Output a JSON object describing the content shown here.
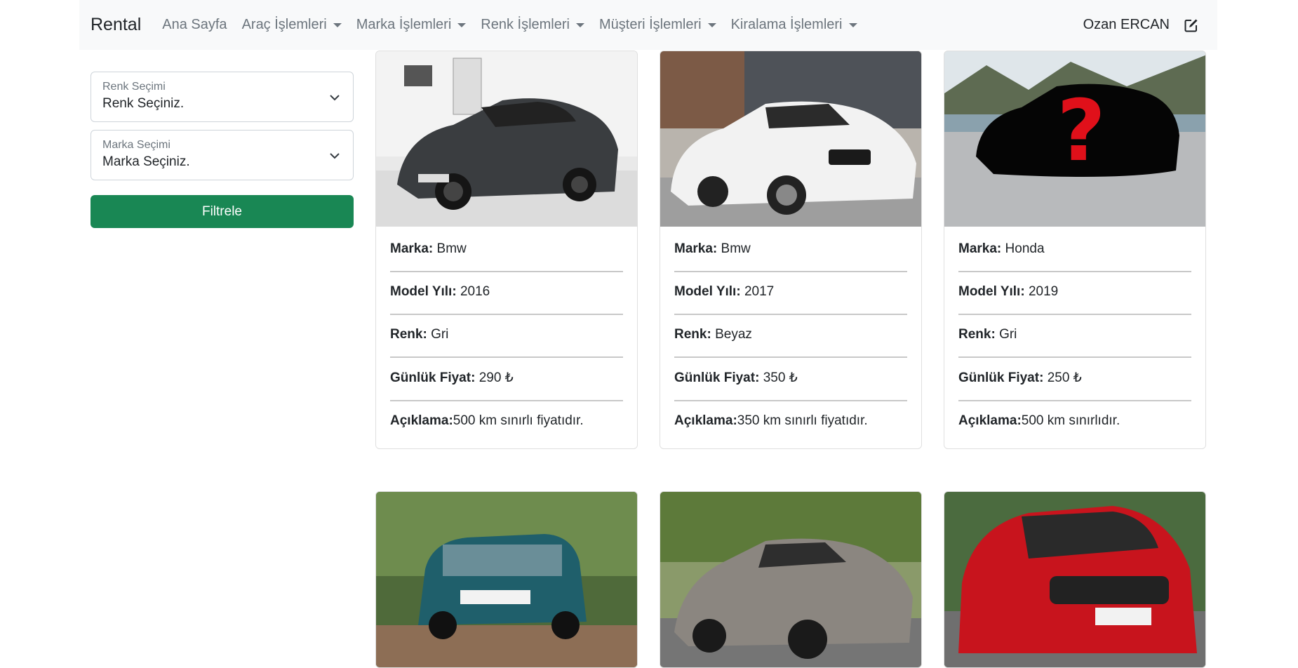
{
  "navbar": {
    "brand": "Rental",
    "items": [
      {
        "label": "Ana Sayfa",
        "dropdown": false
      },
      {
        "label": "Araç İşlemleri",
        "dropdown": true
      },
      {
        "label": "Marka İşlemleri",
        "dropdown": true
      },
      {
        "label": "Renk İşlemleri",
        "dropdown": true
      },
      {
        "label": "Müşteri İşlemleri",
        "dropdown": true
      },
      {
        "label": "Kiralama İşlemleri",
        "dropdown": true
      }
    ],
    "user_name": "Ozan ERCAN",
    "edit_icon": "edit-icon"
  },
  "filters": {
    "color_select": {
      "label": "Renk Seçimi",
      "value": "Renk Seçiniz."
    },
    "brand_select": {
      "label": "Marka Seçimi",
      "value": "Marka Seçiniz."
    },
    "filter_button": "Filtrele"
  },
  "cards": [
    {
      "brand_label": "Marka:",
      "brand": "Bmw",
      "year_label": "Model Yılı:",
      "year": "2016",
      "color_label": "Renk:",
      "color": "Gri",
      "price_label": "Günlük Fiyat:",
      "price": "290 ₺",
      "desc_label": "Açıklama:",
      "desc": "500 km sınırlı fiyatıdır."
    },
    {
      "brand_label": "Marka:",
      "brand": "Bmw",
      "year_label": "Model Yılı:",
      "year": "2017",
      "color_label": "Renk:",
      "color": "Beyaz",
      "price_label": "Günlük Fiyat:",
      "price": "350 ₺",
      "desc_label": "Açıklama:",
      "desc": "350 km sınırlı fiyatıdır."
    },
    {
      "brand_label": "Marka:",
      "brand": "Honda",
      "year_label": "Model Yılı:",
      "year": "2019",
      "color_label": "Renk:",
      "color": "Gri",
      "price_label": "Günlük Fiyat:",
      "price": "250 ₺",
      "desc_label": "Açıklama:",
      "desc": "500 km sınırlıdır."
    }
  ],
  "colors": {
    "navbar_bg": "#f8f9fa",
    "filter_button_bg": "#198754",
    "nav_text": "#6c757d"
  }
}
